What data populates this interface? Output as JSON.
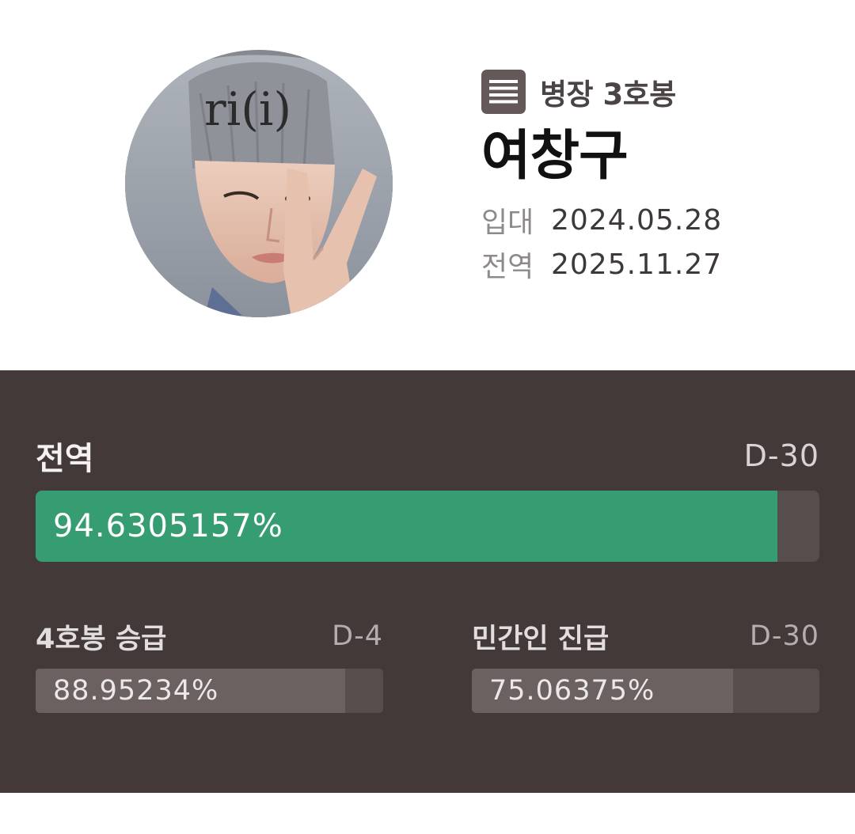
{
  "profile": {
    "rank": "병장 3호봉",
    "name": "여창구",
    "enlist_label": "입대",
    "enlist_date": "2024.05.28",
    "discharge_label": "전역",
    "discharge_date": "2025.11.27",
    "rank_icon": "list-icon"
  },
  "main_progress": {
    "title": "전역",
    "dday": "D-30",
    "percent_text": "94.6305157%",
    "percent_value": 94.6305157
  },
  "sub_progress": [
    {
      "title": "4호봉 승급",
      "dday": "D-4",
      "percent_text": "88.95234%",
      "percent_value": 88.95234
    },
    {
      "title": "민간인 진급",
      "dday": "D-30",
      "percent_text": "75.06375%",
      "percent_value": 75.06375
    }
  ],
  "colors": {
    "panel_bg": "#423938",
    "rank_icon_bg": "#655858",
    "main_fill": "#359d71",
    "main_track": "#574d4c",
    "sub_fill": "#6a6160",
    "sub_track": "#574d4c"
  }
}
